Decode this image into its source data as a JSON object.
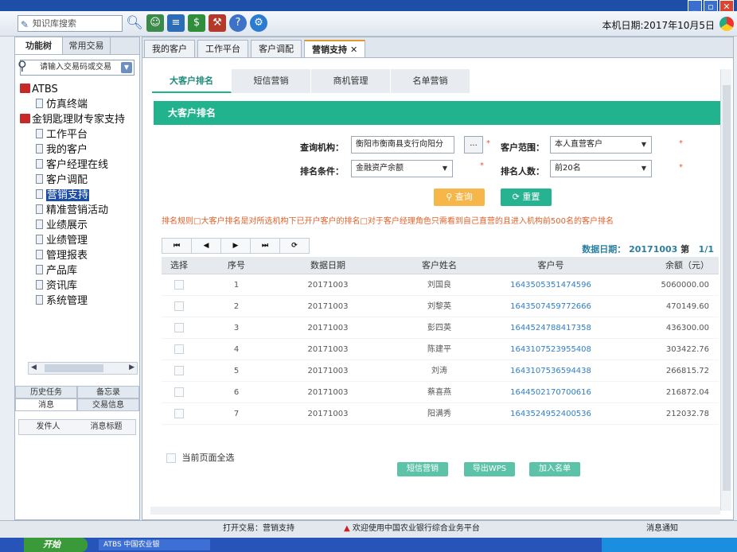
{
  "toolbar": {
    "kb_search_placeholder": "知识库搜索",
    "system_date": "本机日期:2017年10月5日"
  },
  "left_panel": {
    "tabs": [
      "功能树",
      "常用交易"
    ],
    "trade_input_placeholder": "请输入交易码或交易",
    "tree": [
      {
        "label": "ATBS",
        "level": 0,
        "icon": "book-icon"
      },
      {
        "label": "仿真终端",
        "level": 1,
        "icon": "doc-icon"
      },
      {
        "label": "金钥匙理财专家支持",
        "level": 0,
        "icon": "book-icon"
      },
      {
        "label": "工作平台",
        "level": 1,
        "icon": "doc-icon"
      },
      {
        "label": "我的客户",
        "level": 1,
        "icon": "doc-icon"
      },
      {
        "label": "客户经理在线",
        "level": 1,
        "icon": "doc-icon"
      },
      {
        "label": "客户调配",
        "level": 1,
        "icon": "doc-icon"
      },
      {
        "label": "营销支持",
        "level": 1,
        "icon": "doc-icon",
        "selected": true
      },
      {
        "label": "精准营销活动",
        "level": 1,
        "icon": "doc-icon"
      },
      {
        "label": "业绩展示",
        "level": 1,
        "icon": "doc-icon"
      },
      {
        "label": "业绩管理",
        "level": 1,
        "icon": "doc-icon"
      },
      {
        "label": "管理报表",
        "level": 1,
        "icon": "doc-icon"
      },
      {
        "label": "产品库",
        "level": 1,
        "icon": "doc-icon"
      },
      {
        "label": "资讯库",
        "level": 1,
        "icon": "doc-icon"
      },
      {
        "label": "系统管理",
        "level": 1,
        "icon": "doc-icon"
      }
    ],
    "bottom_tabs_row1": [
      "历史任务",
      "备忘录"
    ],
    "bottom_tabs_row2": [
      "消息",
      "交易信息"
    ],
    "message_columns": [
      "发件人",
      "消息标题"
    ]
  },
  "main": {
    "tabs": [
      "我的客户",
      "工作平台",
      "客户调配",
      "营销支持"
    ],
    "sub_tabs": [
      "大客户排名",
      "短信营销",
      "商机管理",
      "名单营销"
    ],
    "section_title": "大客户排名",
    "form": {
      "org_label": "查询机构：",
      "org_value": "衡阳市衡南县支行向阳分",
      "org_picker": "...",
      "scope_label": "客户范围：",
      "scope_value": "本人直营客户",
      "cond_label": "排名条件：",
      "cond_value": "金融资产余额",
      "count_label": "排名人数：",
      "count_value": "前20名"
    },
    "query_button": "查询",
    "reset_button": "重置",
    "rule_text": "排名规则□大客户排名是对所选机构下已开户客户的排名□对于客户经理角色只需看到自己直营的且进入机构前500名的客户排名",
    "pager": [
      "⏮",
      "◀",
      "▶",
      "⏭",
      "⟳"
    ],
    "data_date_label": "数据日期：",
    "data_date_value": "20171003",
    "page_info": "第",
    "page_count": "1/1",
    "table": {
      "columns": [
        "选择",
        "序号",
        "数据日期",
        "客户姓名",
        "客户号",
        "余额（元）"
      ],
      "rows": [
        [
          "1",
          "20171003",
          "刘国良",
          "1643505351474596",
          "5060000.00"
        ],
        [
          "2",
          "20171003",
          "刘黎英",
          "1643507459772666",
          "470149.60"
        ],
        [
          "3",
          "20171003",
          "彭四英",
          "1644524788417358",
          "436300.00"
        ],
        [
          "4",
          "20171003",
          "陈建平",
          "1643107523955408",
          "303422.76"
        ],
        [
          "5",
          "20171003",
          "刘涛",
          "1643107536594438",
          "266815.72"
        ],
        [
          "6",
          "20171003",
          "蔡喜燕",
          "1644502170700616",
          "216872.04"
        ],
        [
          "7",
          "20171003",
          "阳满秀",
          "1643524952400536",
          "212032.78"
        ]
      ]
    },
    "select_all_label": "当前页面全选",
    "bottom_buttons": [
      "短信营销",
      "导出WPS",
      "加入名单"
    ]
  },
  "status": {
    "open_trade": "打开交易：营销支持",
    "welcome": "欢迎使用中国农业银行综合业务平台",
    "msg_notice": "消息通知"
  },
  "taskbar": {
    "start": "开始",
    "task": "ATBS 中国农业银"
  }
}
